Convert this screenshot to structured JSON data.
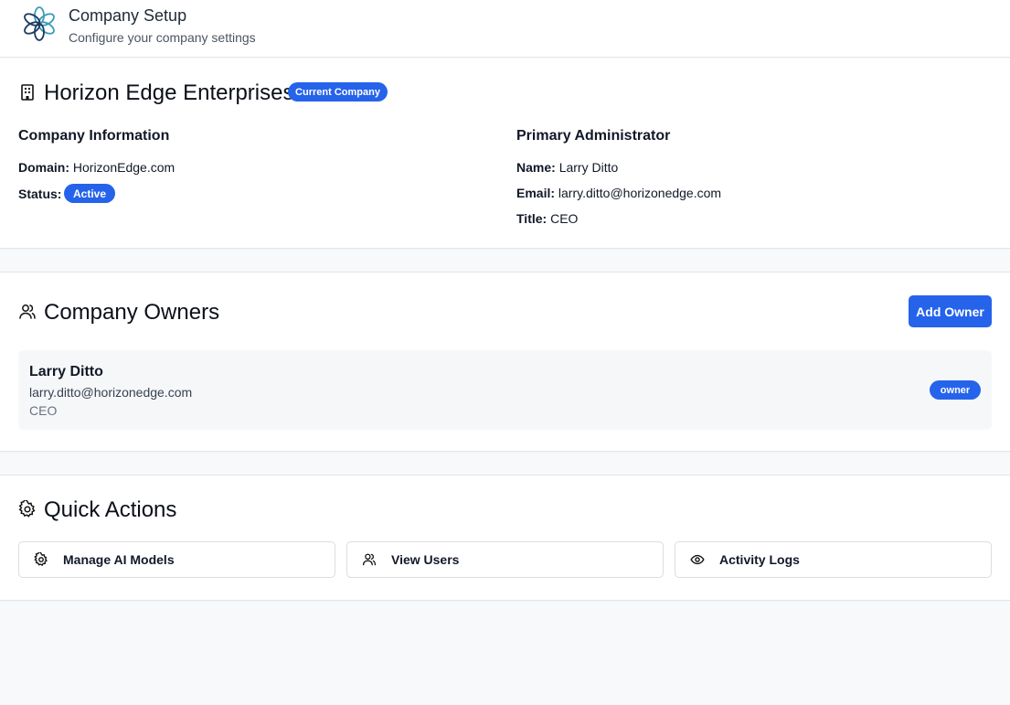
{
  "header": {
    "title": "Company Setup",
    "subtitle": "Configure your company settings",
    "logo_icon": "flower-logo-icon"
  },
  "company": {
    "name": "Horizon Edge Enterprises",
    "current_badge": "Current Company",
    "info_heading": "Company Information",
    "domain_label": "Domain:",
    "domain_value": "HorizonEdge.com",
    "status_label": "Status:",
    "status_value": "Active",
    "admin_heading": "Primary Administrator",
    "admin_name_label": "Name:",
    "admin_name_value": "Larry Ditto",
    "admin_email_label": "Email:",
    "admin_email_value": "larry.ditto@horizonedge.com",
    "admin_title_label": "Title:",
    "admin_title_value": "CEO"
  },
  "owners": {
    "heading": "Company Owners",
    "add_button": "Add Owner",
    "list": [
      {
        "name": "Larry Ditto",
        "email": "larry.ditto@horizonedge.com",
        "title": "CEO",
        "role": "owner"
      }
    ]
  },
  "quick_actions": {
    "heading": "Quick Actions",
    "items": [
      {
        "label": "Manage AI Models",
        "icon": "gear-icon"
      },
      {
        "label": "View Users",
        "icon": "users-icon"
      },
      {
        "label": "Activity Logs",
        "icon": "eye-icon"
      }
    ]
  },
  "colors": {
    "accent": "#2563eb",
    "page_bg": "#f8f9fb",
    "card_bg": "#ffffff"
  }
}
